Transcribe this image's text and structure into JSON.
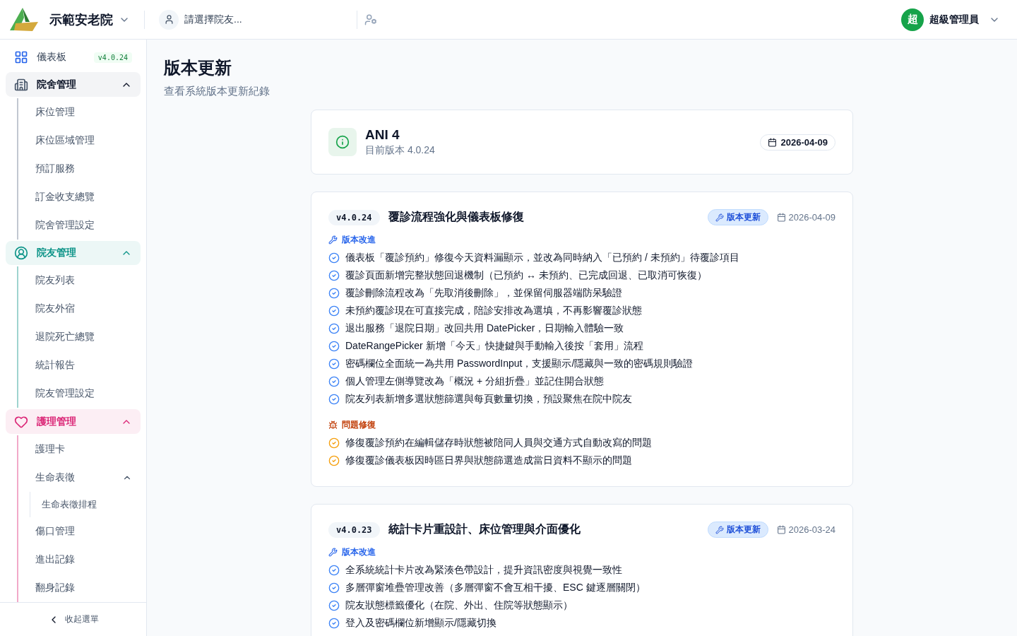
{
  "header": {
    "org_name": "示範安老院",
    "resident_picker": {
      "placeholder": "請選擇院友..."
    },
    "user": {
      "avatar_initial": "超",
      "name": "超級管理員"
    }
  },
  "sidebar": {
    "dashboard": {
      "label": "儀表板",
      "version": "v4.0.24"
    },
    "groups": [
      {
        "label": "院舍管理",
        "color": "#64748b",
        "expanded": true,
        "items": [
          {
            "label": "床位管理"
          },
          {
            "label": "床位區域管理"
          },
          {
            "label": "預訂服務"
          },
          {
            "label": "訂金收支總覽"
          },
          {
            "label": "院舍管理設定"
          }
        ]
      },
      {
        "label": "院友管理",
        "color": "#0d9488",
        "expanded": true,
        "items": [
          {
            "label": "院友列表"
          },
          {
            "label": "院友外宿"
          },
          {
            "label": "退院死亡總覽"
          },
          {
            "label": "統計報告"
          },
          {
            "label": "院友管理設定"
          }
        ]
      },
      {
        "label": "護理管理",
        "color": "#db2777",
        "expanded": true,
        "items": [
          {
            "label": "護理卡"
          },
          {
            "label": "生命表徵",
            "expanded": true,
            "children": [
              {
                "label": "生命表徵排程"
              }
            ]
          },
          {
            "label": "傷口管理"
          },
          {
            "label": "進出記錄"
          },
          {
            "label": "翻身記錄"
          }
        ]
      }
    ],
    "collapse_label": "收起選單"
  },
  "page": {
    "title": "版本更新",
    "subtitle": "查看系統版本更新紀錄"
  },
  "current": {
    "app_name": "ANI 4",
    "version_label": "目前版本 4.0.24",
    "date": "2026-04-09"
  },
  "releases": [
    {
      "version": "v4.0.24",
      "title": "覆診流程強化與儀表板修復",
      "tag": "版本更新",
      "date": "2026-04-09",
      "sections": [
        {
          "kind": "improvement",
          "heading": "版本改進",
          "entries": [
            "儀表板「覆診預約」修復今天資料漏顯示，並改為同時納入「已預約 / 未預約」待覆診項目",
            "覆診頁面新增完整狀態回退機制（已預約 ↔ 未預約、已完成回退、已取消可恢復）",
            "覆診刪除流程改為「先取消後刪除」，並保留伺服器端防呆驗證",
            "未預約覆診現在可直接完成，陪診安排改為選填，不再影響覆診狀態",
            "退出服務「退院日期」改回共用 DatePicker，日期輸入體驗一致",
            "DateRangePicker 新增「今天」快捷鍵與手動輸入後按「套用」流程",
            "密碼欄位全面統一為共用 PasswordInput，支援顯示/隱藏與一致的密碼規則驗證",
            "個人管理左側導覽改為「概況 + 分組折疊」並記住開合狀態",
            "院友列表新增多選狀態篩選與每頁數量切換，預設聚焦在院中院友"
          ]
        },
        {
          "kind": "fix",
          "heading": "問題修復",
          "entries": [
            "修復覆診預約在編輯儲存時狀態被陪同人員與交通方式自動改寫的問題",
            "修復覆診儀表板因時區日界與狀態篩選造成當日資料不顯示的問題"
          ]
        }
      ]
    },
    {
      "version": "v4.0.23",
      "title": "統計卡片重設計、床位管理與介面優化",
      "tag": "版本更新",
      "date": "2026-03-24",
      "sections": [
        {
          "kind": "improvement",
          "heading": "版本改進",
          "entries": [
            "全系統統計卡片改為緊湊色帶設計，提升資訊密度與視覺一致性",
            "多層彈窗堆疊管理改善（多層彈窗不會互相干擾、ESC 鍵逐層關閉）",
            "院友狀態標籤優化（在院、外出、住院等狀態顯示）",
            "登入及密碼欄位新增顯示/隱藏切換"
          ]
        }
      ]
    }
  ]
}
